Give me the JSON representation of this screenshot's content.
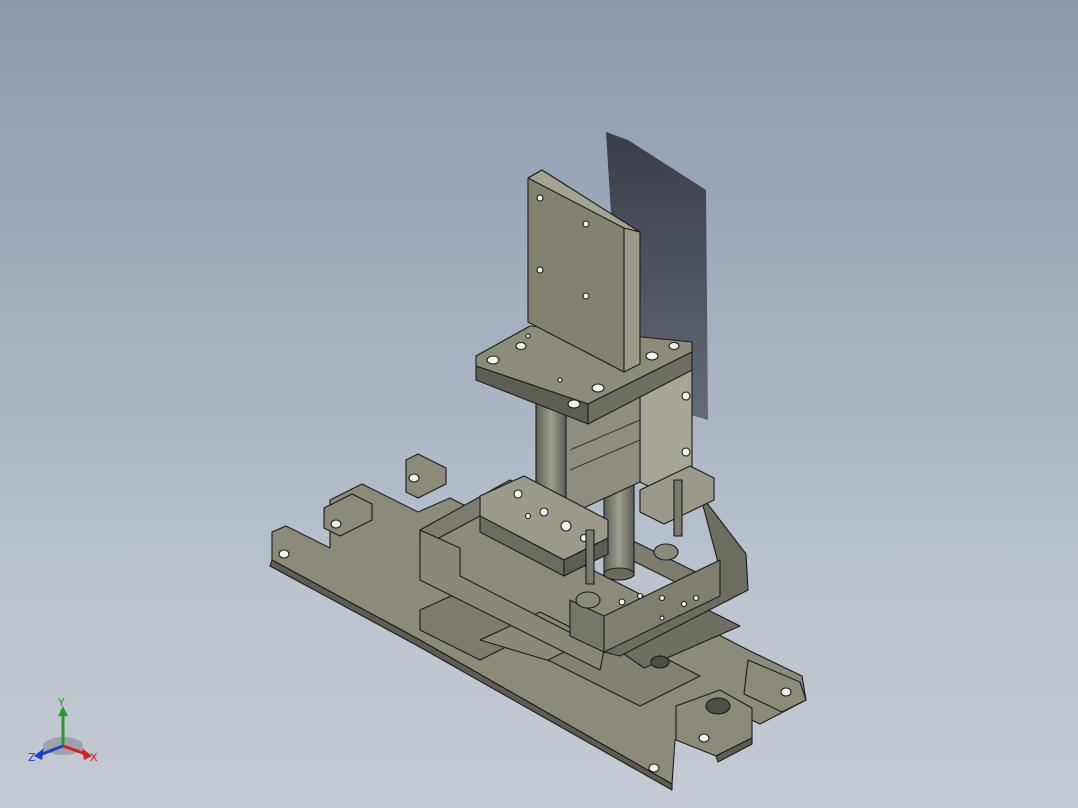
{
  "viewport": {
    "background_top": "#8c9aad",
    "background_bottom": "#c4cad3"
  },
  "model": {
    "face_color_light": "#8c8b79",
    "face_color_mid": "#77766a",
    "face_color_dark": "#5e5d54",
    "edge_color": "#1c1c1a",
    "shadow_color": "#2a2e36"
  },
  "triad": {
    "x_label": "X",
    "y_label": "Y",
    "z_label": "Z",
    "x_color": "#d42020",
    "y_color": "#2a9a2a",
    "z_color": "#2040c8"
  }
}
